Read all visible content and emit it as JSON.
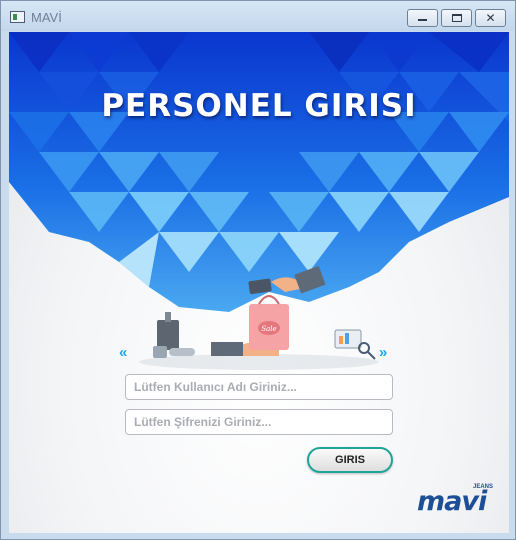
{
  "window": {
    "title": "MAVİ",
    "controls": {
      "minimize_icon": "minimize-icon",
      "maximize_icon": "maximize-icon",
      "close_glyph": "✕"
    }
  },
  "header": {
    "title": "PERSONEL GIRISI"
  },
  "illustration": {
    "sale_tag": "Sale",
    "nav_left": "«",
    "nav_right": "»"
  },
  "form": {
    "username": {
      "value": "",
      "placeholder": "Lütfen Kullanıcı Adı Giriniz..."
    },
    "password": {
      "value": "",
      "placeholder": "Lütfen Şifrenizi Giriniz..."
    },
    "login_label": "GIRIS"
  },
  "brand": {
    "name": "mavi",
    "sub": "JEANS"
  },
  "colors": {
    "banner_dark": "#0a3fd6",
    "banner_mid": "#1a7fe8",
    "banner_light": "#7fd0fa",
    "button_border": "#1fa49a",
    "brand": "#1d4f96"
  }
}
